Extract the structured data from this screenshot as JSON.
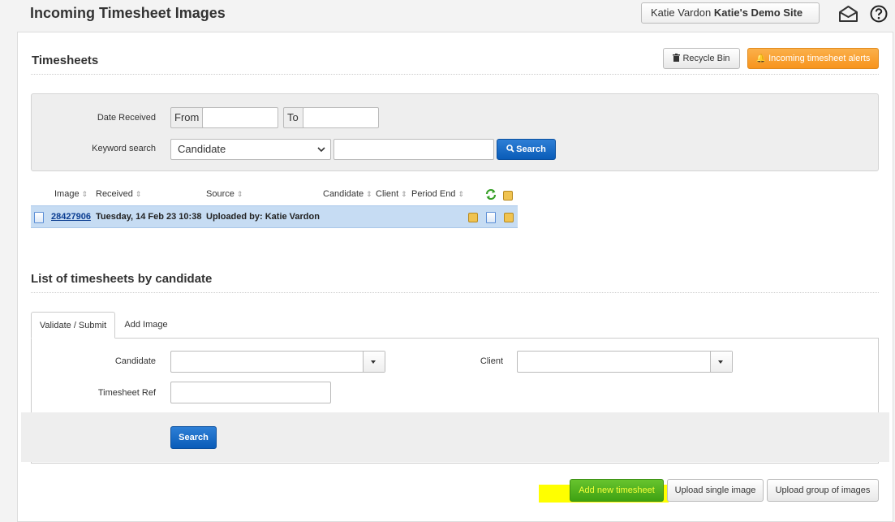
{
  "header": {
    "title": "Incoming Timesheet Images",
    "user_name": "Katie Vardon",
    "site_name": "Katie's Demo Site"
  },
  "timesheets": {
    "title": "Timesheets",
    "recycle_bin_label": "Recycle Bin",
    "alerts_label": "Incoming timesheet alerts"
  },
  "filter": {
    "date_received_label": "Date Received",
    "from_label": "From",
    "to_label": "To",
    "keyword_label": "Keyword search",
    "keyword_type_selected": "Candidate",
    "search_label": "Search"
  },
  "table": {
    "columns": [
      "Image",
      "Received",
      "Source",
      "Candidate",
      "Client",
      "Period End"
    ],
    "rows": [
      {
        "image": "28427906",
        "received": "Tuesday, 14 Feb 23 10:38",
        "source": "Uploaded by: Katie Vardon"
      }
    ]
  },
  "by_candidate": {
    "title": "List of timesheets by candidate",
    "tabs": [
      "Validate / Submit",
      "Add Image"
    ],
    "candidate_label": "Candidate",
    "client_label": "Client",
    "timesheet_ref_label": "Timesheet Ref",
    "search_label": "Search"
  },
  "footer_actions": {
    "add_new_label": "Add new timesheet",
    "upload_single_label": "Upload single image",
    "upload_group_label": "Upload group of images"
  },
  "colors": {
    "accent_orange": "#f7941d",
    "accent_blue": "#0a5cb8",
    "accent_green": "#3fa112",
    "selected_row": "#c6dcf3",
    "highlight": "#ffff00"
  }
}
